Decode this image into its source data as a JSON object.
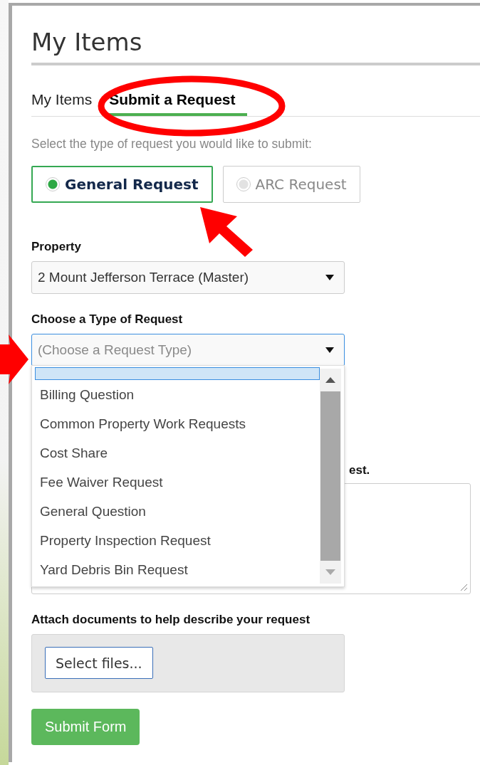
{
  "page": {
    "title": "My Items"
  },
  "tabs": [
    {
      "label": "My Items",
      "selected": false
    },
    {
      "label": "Submit a Request",
      "selected": true
    }
  ],
  "instruction": "Select the type of request you would like to submit:",
  "request_types": [
    {
      "label": "General Request",
      "selected": true
    },
    {
      "label": "ARC Request",
      "selected": false
    }
  ],
  "property": {
    "label": "Property",
    "value": "2 Mount Jefferson Terrace (Master)"
  },
  "request_type": {
    "label": "Choose a Type of Request",
    "value": "(Choose a Request Type)",
    "expanded": true,
    "options": [
      "Billing Question",
      "Common Property Work Requests",
      "Cost Share",
      "Fee Waiver Request",
      "General Question",
      "Property Inspection Request",
      "Yard Debris Bin Request"
    ]
  },
  "description": {
    "label": "est."
  },
  "attachments": {
    "label": "Attach documents to help describe your request",
    "button": "Select files..."
  },
  "submit": "Submit Form"
}
